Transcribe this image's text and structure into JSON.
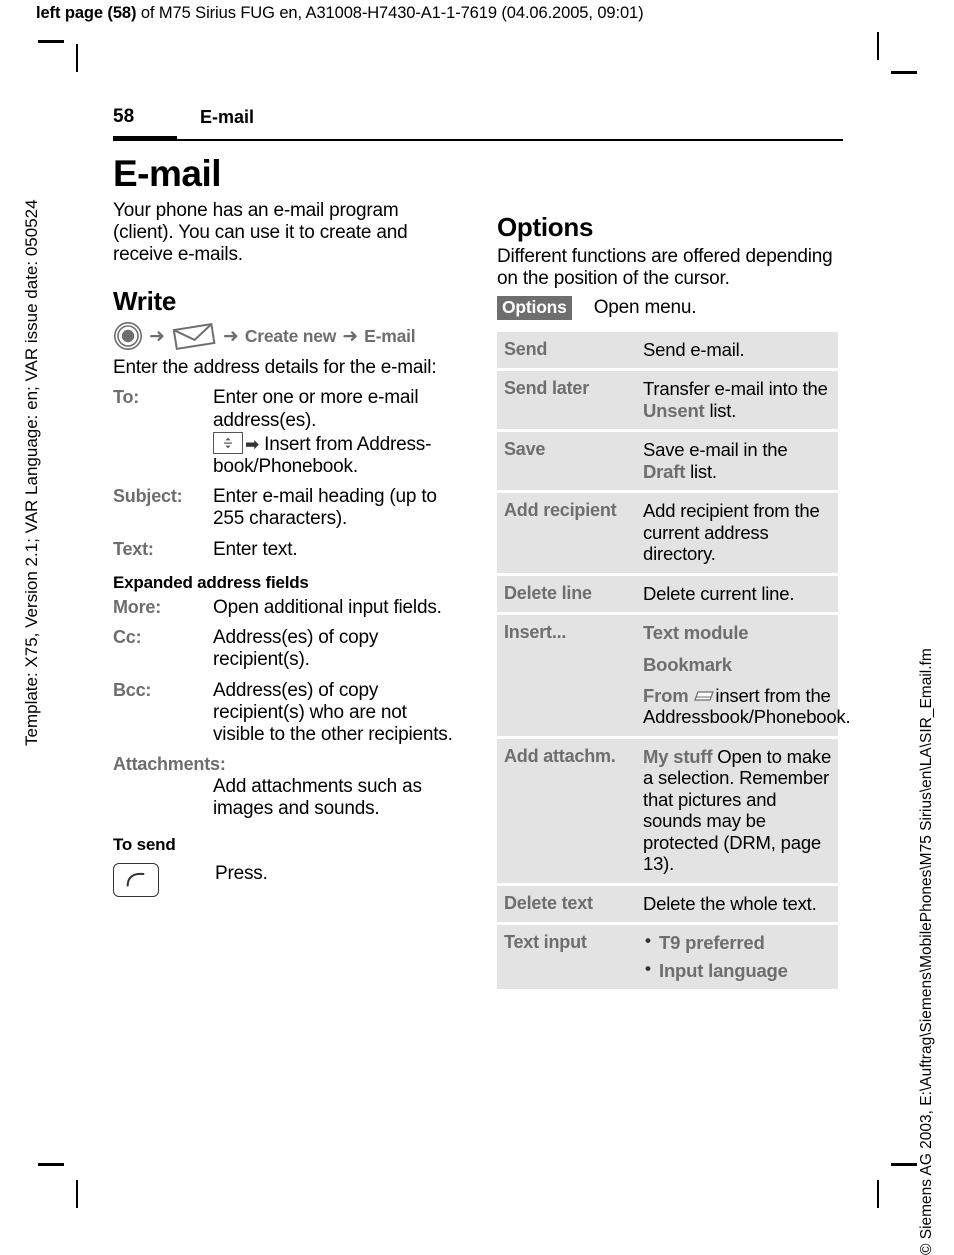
{
  "running_header": {
    "bold_prefix": "left page (58)",
    "rest": " of M75 Sirius FUG en, A31008-H7430-A1-1-7619 (04.06.2005, 09:01)"
  },
  "side_left_text": "Template: X75, Version 2.1; VAR Language: en; VAR issue date: 050524",
  "side_right_text": "© Siemens AG 2003, E:\\Auftrag\\Siemens\\MobilePhones\\M75 Sirius\\en\\LA\\SIR_Email.fm",
  "folio": {
    "page_number": "58",
    "section": "E-mail"
  },
  "left_column": {
    "chapter_title": "E-mail",
    "intro": "Your phone has an e-mail program (client). You can use it to create and receive e-mails.",
    "write": {
      "heading": "Write",
      "nav_path": {
        "arrow": "➜",
        "joystick_icon": "joystick-icon",
        "envelope_icon": "envelope-icon",
        "step_create_new": "Create new",
        "step_email": "E-mail"
      },
      "lead": "Enter the address details for the e-mail:",
      "fields": [
        {
          "term": "To:",
          "def_line1": "Enter one or more e-mail address(es).",
          "key_icon": "navigation-key-icon",
          "key_arrow": "➡",
          "def_line2": "Insert from Address-book/Phonebook."
        },
        {
          "term": "Subject:",
          "def": "Enter e-mail heading (up to 255 characters)."
        },
        {
          "term": "Text:",
          "def": "Enter text."
        }
      ],
      "expanded_heading": "Expanded address fields",
      "expanded_fields": [
        {
          "term": "More:",
          "def": "Open additional input fields."
        },
        {
          "term": "Cc:",
          "def": "Address(es) of copy recipient(s)."
        },
        {
          "term": "Bcc:",
          "def": "Address(es) of copy recipient(s) who are not visible to the other recipients."
        },
        {
          "term": "Attachments:",
          "def": "Add attachments such as images and sounds."
        }
      ],
      "to_send_heading": "To send",
      "call_key_icon": "call-key-icon",
      "to_send_text": "Press."
    }
  },
  "right_column": {
    "options": {
      "heading": "Options",
      "intro": "Different functions are offered depending on the position of the cursor.",
      "softkey_label": "Options",
      "softkey_desc": "Open menu.",
      "rows": [
        {
          "name": "Send",
          "desc": "Send e-mail."
        },
        {
          "name": "Send later",
          "desc_pre": "Transfer e-mail into the ",
          "desc_term": "Unsent",
          "desc_post": " list."
        },
        {
          "name": "Save",
          "desc_pre": "Save e-mail in the ",
          "desc_term": "Draft",
          "desc_post": " list."
        },
        {
          "name": "Add recipient",
          "desc": "Add recipient from the current address directory."
        },
        {
          "name": "Delete line",
          "desc": "Delete current line."
        },
        {
          "name": "Insert...",
          "sub_items": [
            "Text module",
            "Bookmark"
          ],
          "from_label": "From",
          "from_icon": "addressbook-icon",
          "from_text": "insert from the Addressbook/Phonebook."
        },
        {
          "name": "Add attachm.",
          "desc_term": "My stuff",
          "desc_post": " Open to make a selection. Remember that pictures and sounds may be protected (DRM, page 13)."
        },
        {
          "name": "Delete text",
          "desc": "Delete the whole text."
        },
        {
          "name": "Text input",
          "bullets": [
            "T9 preferred",
            "Input language"
          ]
        }
      ]
    }
  },
  "colors": {
    "gray_text": "#6e6e6e",
    "row_bg": "#e3e3e3",
    "softkey_bg": "#6e6e6e"
  }
}
